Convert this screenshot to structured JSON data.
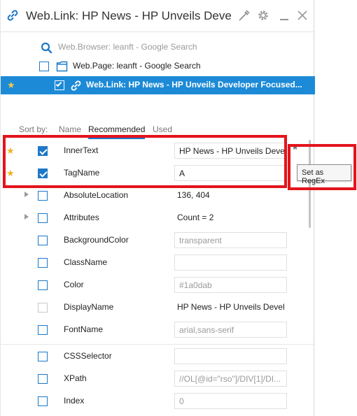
{
  "window": {
    "title": "Web.Link: HP News - HP Unveils Devel..."
  },
  "hierarchy": [
    {
      "label": "Web.Browser: leanft - Google Search",
      "icon": "search-icon"
    },
    {
      "label": "Web.Page: leanft - Google Search",
      "icon": "page-icon"
    },
    {
      "label": "Web.Link: HP News - HP Unveils Developer Focused...",
      "icon": "link-icon",
      "selected": true
    }
  ],
  "sort": {
    "label": "Sort by:",
    "options": [
      "Name",
      "Recommended",
      "Used"
    ],
    "active": "Recommended"
  },
  "properties": [
    {
      "name": "InnerText",
      "value": "HP News - HP Unveils Develo",
      "starred": true,
      "checked": true
    },
    {
      "name": "TagName",
      "value": "A",
      "starred": true,
      "checked": true
    },
    {
      "name": "AbsoluteLocation",
      "value": "136, 404",
      "expandable": true,
      "checked": false
    },
    {
      "name": "Attributes",
      "value": "Count = 2",
      "expandable": true,
      "checked": false
    },
    {
      "name": "BackgroundColor",
      "value": "transparent",
      "checked": false
    },
    {
      "name": "ClassName",
      "value": "",
      "checked": false
    },
    {
      "name": "Color",
      "value": "#1a0dab",
      "checked": false
    },
    {
      "name": "DisplayName",
      "value": "HP News - HP Unveils Devel",
      "checked": false,
      "disabled": true
    },
    {
      "name": "FontName",
      "value": "arial,sans-serif",
      "checked": false
    },
    {
      "name": "CSSSelector",
      "value": "",
      "checked": false
    },
    {
      "name": "XPath",
      "value": "//OL[@id=\"rso\"]/DIV[1]/DI...",
      "checked": false
    },
    {
      "name": "Index",
      "value": "0",
      "checked": false
    }
  ],
  "regex_button": {
    "symbol": "*"
  },
  "tooltip": {
    "text": "Set as RegEx"
  },
  "colors": {
    "accent": "#1c8ad6",
    "highlight_box": "#e3141c",
    "star": "#f2b01e"
  }
}
